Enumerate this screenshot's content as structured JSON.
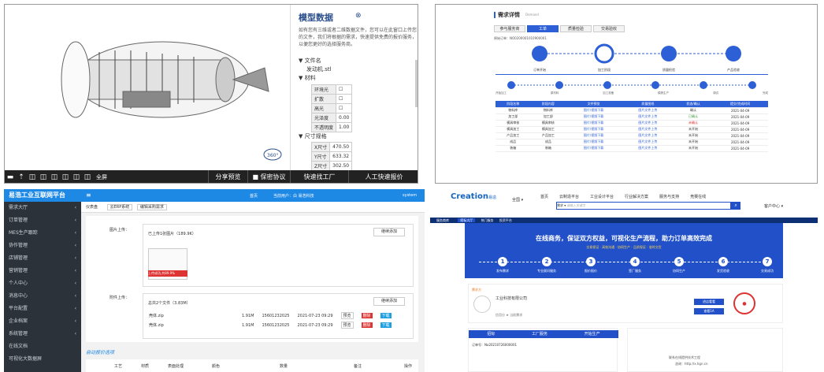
{
  "panel1": {
    "title": "模型数据",
    "desc": "如有您有三维或者二维数据文件，您可以在此窗口上传您的文件，我们将根据的需求，快速提供免费的报价服务，以便您更好的选择服务商。",
    "filename_label": "文件名",
    "filename": "发动机.stl",
    "material_label": "材料",
    "materials": [
      {
        "label": "环境光",
        "value": ""
      },
      {
        "label": "扩散",
        "value": ""
      },
      {
        "label": "高光",
        "value": ""
      },
      {
        "label": "光泽度",
        "value": "0.00"
      },
      {
        "label": "不透明度",
        "value": "1.00"
      }
    ],
    "size_label": "尺寸规格",
    "sizes": [
      {
        "label": "X尺寸",
        "value": "470.50"
      },
      {
        "label": "Y尺寸",
        "value": "633.32"
      },
      {
        "label": "Z尺寸",
        "value": "302.50"
      }
    ],
    "fullscreen": "全屏",
    "share": "分享预览",
    "secrecy": "保密协议",
    "find_factory": "快速找工厂",
    "quote": "人工快速报价",
    "badge": "360°"
  },
  "panel2": {
    "title": "需求详情",
    "subtitle": "Demand",
    "tabs": [
      "参与服务商",
      "工单",
      "质量检验",
      "交易验收"
    ],
    "order_line": "原始订单：NO0200001010900001",
    "steps": [
      "订单开始",
      "加工阶段",
      "质量检验",
      "产品验收"
    ],
    "substeps": [
      "开始加工",
      "原材料",
      "加工准备",
      "模具生产",
      "调试",
      "完成"
    ],
    "headers": [
      "阶段名称",
      "阶段内容",
      "文件预览",
      "质量图纸",
      "状态/确认",
      "提交/完成时间"
    ],
    "rows": [
      [
        "物料库",
        "物料库",
        "图片/视频下载",
        "图片文件上传",
        "确认",
        "2021-04-09"
      ],
      [
        "加工部",
        "加工部",
        "图片/视频下载",
        "图片文件上传",
        "已确认",
        "2021-04-09"
      ],
      [
        "模具审核",
        "模具审核",
        "图片/视频下载",
        "图片文件上传",
        "未确认",
        "2021-04-09"
      ],
      [
        "模具加工",
        "模具加工",
        "图片/视频下载",
        "图片文件上传",
        "未开始",
        "2021-04-09"
      ],
      [
        "产品加工",
        "产品加工",
        "图片/视频下载",
        "图片文件上传",
        "未开始",
        "2021-04-09"
      ],
      [
        "成品",
        "成品",
        "图片/视频下载",
        "图片文件上传",
        "未开始",
        "2021-04-09"
      ],
      [
        "装箱",
        "装箱",
        "图片/视频下载",
        "图片文件上传",
        "未开始",
        "2021-04-09"
      ]
    ]
  },
  "panel3": {
    "brand": "易浩工业互联网平台",
    "nav": [
      "需求大厅",
      "订单管理",
      "MES生产跟踪",
      "协作管理",
      "店铺管理",
      "营销管理",
      "个人中心",
      "消息中心",
      "平台配置",
      "企业档案",
      "系统管理",
      "在线文档",
      "可视化大数据屏"
    ],
    "top_items": [
      "首页",
      "当前用户：白 易浩科技",
      "system"
    ],
    "crumbs": [
      "仪表盘",
      "云ERP系统",
      "编辑采购需求"
    ],
    "img_label": "图片上传：",
    "img_info": "已上传1张图片（189.9K）",
    "img_btn": "继续添加",
    "img_tag": "上传成功,共89.9%",
    "att_label": "附件上传：",
    "att_info": "总共2个文件（3.83M）",
    "att_btn": "继续添加",
    "files": [
      {
        "name": "壳体.zip",
        "size": "1.91M",
        "user": "15601232025",
        "time": "2021-07-23 09:29"
      },
      {
        "name": "壳体.zip",
        "size": "1.91M",
        "user": "15601232025",
        "time": "2021-07-23 09:29"
      }
    ],
    "file_actions": [
      "预览",
      "删除",
      "下载"
    ],
    "section": "自动报价选项",
    "table_headers": [
      "工艺",
      "材质",
      "表面处理",
      "颜色",
      "数量",
      "备注",
      "操作"
    ]
  },
  "panel4": {
    "brand": "Creation",
    "brand_suffix": "易造",
    "nav": [
      "首页",
      "云制造平台",
      "工业设计平台",
      "行业解决方案",
      "服务与支持",
      "竞赛在线"
    ],
    "search_placeholder": "请输入关键字",
    "search_type": "需求",
    "scope": "全国",
    "user": "客户中心",
    "sub_nav": [
      "服务商库",
      "招标大厅",
      "热门服务",
      "投资平台"
    ],
    "hero_title": "在线商务，保证双方权益，可视化生产流程，助力订单高效完成",
    "hero_sub": "交易保证 · 高效沟通 · 协同生产 · 品质保证 · 准时交货",
    "steps": [
      {
        "n": "1",
        "label": "发布需求"
      },
      {
        "n": "2",
        "label": "专业顾问服务"
      },
      {
        "n": "3",
        "label": "报价报价"
      },
      {
        "n": "4",
        "label": "签厂服务"
      },
      {
        "n": "5",
        "label": "协同生产"
      },
      {
        "n": "6",
        "label": "发货验收"
      },
      {
        "n": "7",
        "label": "交易成功"
      }
    ],
    "tag": "需求方",
    "company": "工业科技有限公司",
    "stat_line": "信用分 ★ 当前需求",
    "btn1": "进店看看",
    "btn2": "查看1A",
    "flow": [
      "招标",
      "工厂服务",
      "开始生产"
    ],
    "order_no": "订单号：No20210726000001",
    "right_text": "联系在线提供技术工程",
    "right_sub": "咨询：http://x.hgn.cn"
  }
}
